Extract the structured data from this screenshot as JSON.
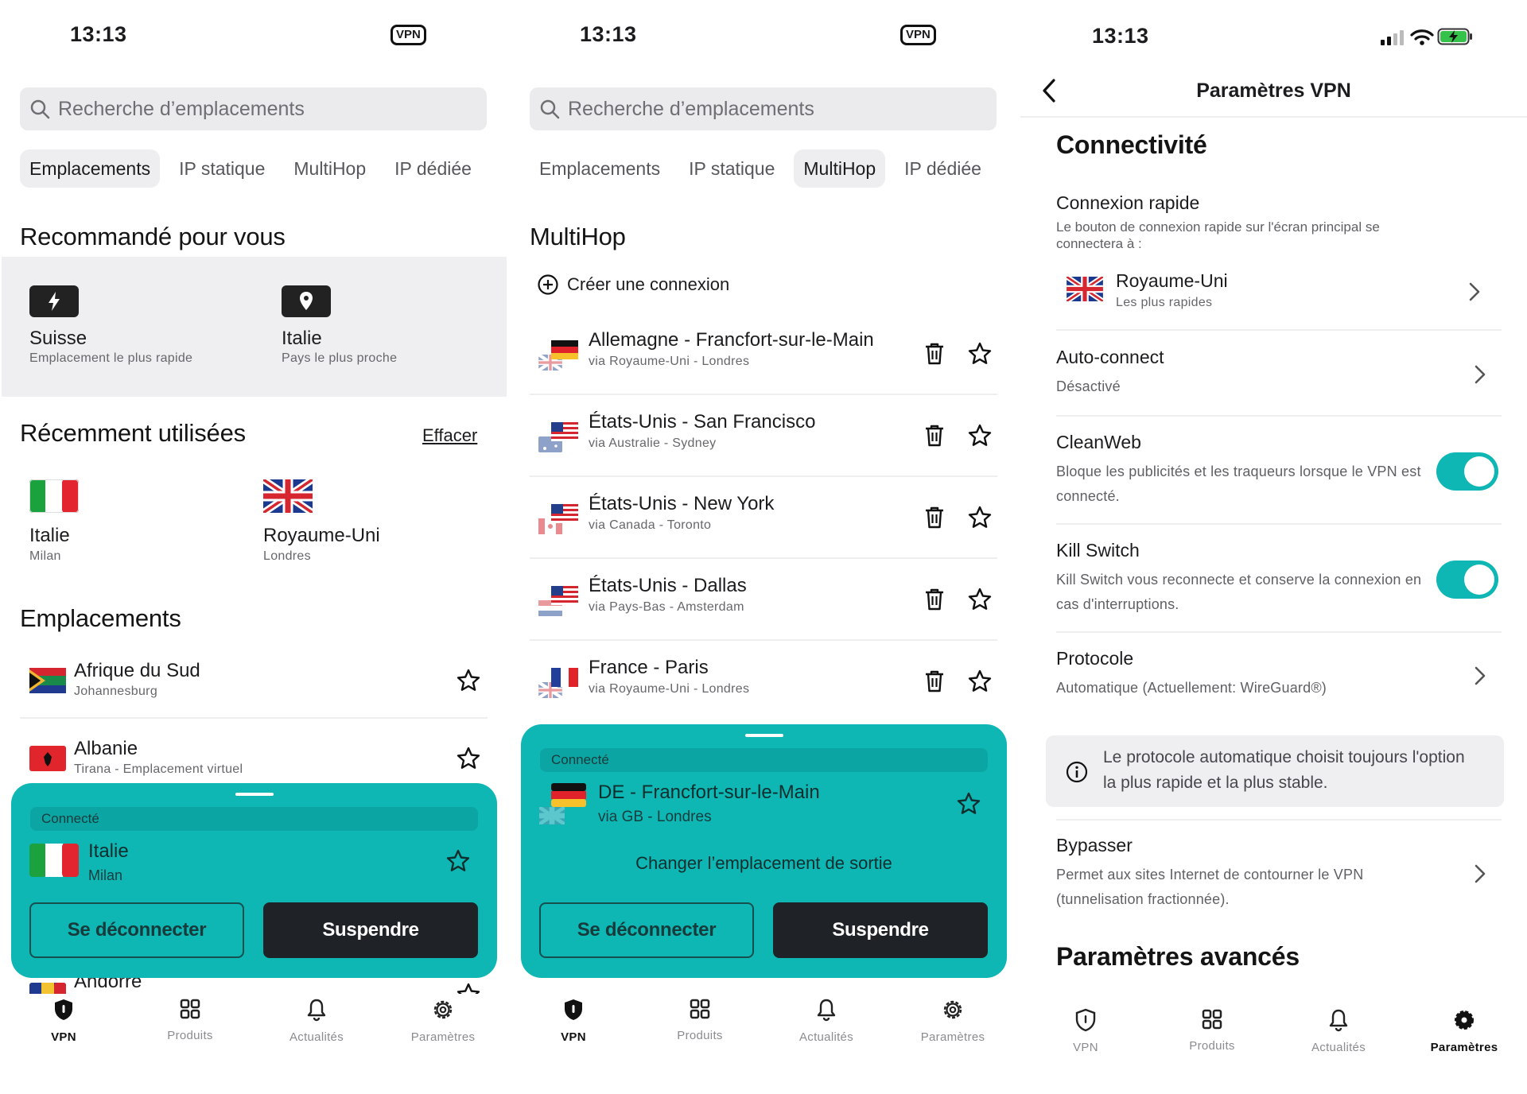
{
  "status": {
    "time": "13:13",
    "vpn_badge": "VPN"
  },
  "search": {
    "placeholder": "Recherche d’emplacements"
  },
  "tabs": [
    "Emplacements",
    "IP statique",
    "MultiHop",
    "IP dédiée"
  ],
  "screen1": {
    "recommended_title": "Recommandé pour vous",
    "recommended": [
      {
        "name": "Suisse",
        "sub": "Emplacement le plus rapide",
        "icon": "bolt-icon"
      },
      {
        "name": "Italie",
        "sub": "Pays le plus proche",
        "icon": "location-pin-icon"
      }
    ],
    "recent_title": "Récemment utilisées",
    "clear_label": "Effacer",
    "recent": [
      {
        "name": "Italie",
        "sub": "Milan",
        "flag": "italy-flag-icon"
      },
      {
        "name": "Royaume-Uni",
        "sub": "Londres",
        "flag": "uk-flag-icon"
      }
    ],
    "locations_title": "Emplacements",
    "locations": [
      {
        "name": "Afrique du Sud",
        "sub": "Johannesburg",
        "flag": "south-africa-flag-icon"
      },
      {
        "name": "Albanie",
        "sub": "Tirana - Emplacement virtuel",
        "flag": "albania-flag-icon"
      },
      {
        "name": "Andorre",
        "sub": "",
        "flag": "andorra-flag-icon"
      }
    ],
    "connected": {
      "status": "Connecté",
      "name": "Italie",
      "sub": "Milan"
    }
  },
  "screen2": {
    "title": "MultiHop",
    "create_label": "Créer une connexion",
    "routes": [
      {
        "name": "Allemagne - Francfort-sur-le-Main",
        "via": "via Royaume-Uni - Londres"
      },
      {
        "name": "États-Unis - San Francisco",
        "via": "via Australie - Sydney"
      },
      {
        "name": "États-Unis - New York",
        "via": "via Canada - Toronto"
      },
      {
        "name": "États-Unis - Dallas",
        "via": "via Pays-Bas - Amsterdam"
      },
      {
        "name": "France - Paris",
        "via": "via Royaume-Uni - Londres"
      }
    ],
    "connected": {
      "status": "Connecté",
      "name": "DE - Francfort-sur-le-Main",
      "via": "via GB - Londres",
      "change_exit": "Changer l’emplacement de sortie"
    }
  },
  "buttons": {
    "disconnect": "Se déconnecter",
    "pause": "Suspendre"
  },
  "nav": [
    "VPN",
    "Produits",
    "Actualités",
    "Paramètres"
  ],
  "screen3": {
    "header": "Paramètres VPN",
    "connectivity": "Connectivité",
    "quick_connect": {
      "title": "Connexion rapide",
      "desc": "Le bouton de connexion rapide sur l'écran principal se connectera à :",
      "value": "Royaume-Uni",
      "value_sub": "Les plus rapides"
    },
    "auto_connect": {
      "title": "Auto-connect",
      "value": "Désactivé"
    },
    "cleanweb": {
      "title": "CleanWeb",
      "desc": "Bloque les publicités et les traqueurs lorsque le VPN est connecté.",
      "enabled": true
    },
    "kill_switch": {
      "title": "Kill Switch",
      "desc": "Kill Switch vous reconnecte et conserve la connexion en cas d'interruptions.",
      "enabled": true
    },
    "protocol": {
      "title": "Protocole",
      "value": "Automatique (Actuellement: WireGuard®)"
    },
    "info": "Le protocole automatique choisit toujours l'option la plus rapide et la plus stable.",
    "bypasser": {
      "title": "Bypasser",
      "desc": "Permet aux sites Internet de contourner le VPN (tunnelisation fractionnée)."
    },
    "advanced": "Paramètres avancés"
  },
  "colors": {
    "accent": "#0eb6b4",
    "dark_button": "#1f2226"
  }
}
